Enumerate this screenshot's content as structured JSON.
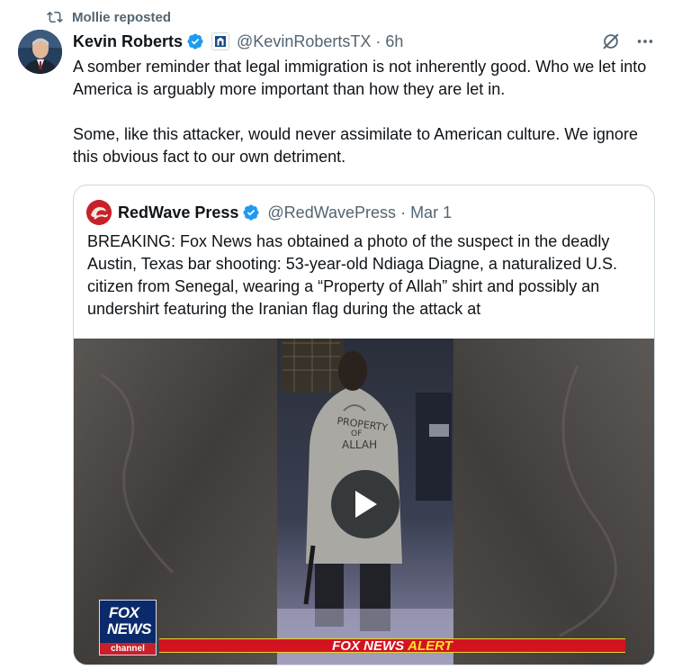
{
  "repost": {
    "text": "Mollie reposted"
  },
  "tweet": {
    "author_name": "Kevin Roberts",
    "handle": "@KevinRobertsTX",
    "separator": "·",
    "time": "6h",
    "paragraphs": [
      "A somber reminder that legal immigration is not inherently good. Who we let into America is arguably more important than how they are let in.",
      "Some, like this attacker, would never assimilate to American culture. We ignore this obvious fact to our own detriment."
    ]
  },
  "quote": {
    "author_name": "RedWave Press",
    "handle": "@RedWavePress",
    "separator": "·",
    "time": "Mar 1",
    "text": "BREAKING: Fox News has obtained a photo of the suspect in the deadly Austin, Texas bar shooting: 53-year-old Ndiaga Diagne, a naturalized U.S. citizen from Senegal, wearing a “Property of Allah” shirt and possibly an undershirt featuring the Iranian flag during the attack at"
  },
  "media": {
    "shirt_text_1": "PROPERTY",
    "shirt_text_2": "OF",
    "shirt_text_3": "ALLAH",
    "logo_line1": "FOX",
    "logo_line2": "NEWS",
    "logo_line3": "channel",
    "alert_part1": "FOX NEWS",
    "alert_part2": "ALERT"
  },
  "icons": [
    "repost-icon",
    "verified-badge-icon",
    "affiliate-badge-icon",
    "grok-icon",
    "more-icon",
    "play-icon"
  ],
  "colors": {
    "verified": "#1d9bf0",
    "secondary_text": "#536471",
    "alert_red": "#d3141f",
    "alert_yellow": "#ffe61f",
    "fox_blue": "#0b2a6b"
  }
}
